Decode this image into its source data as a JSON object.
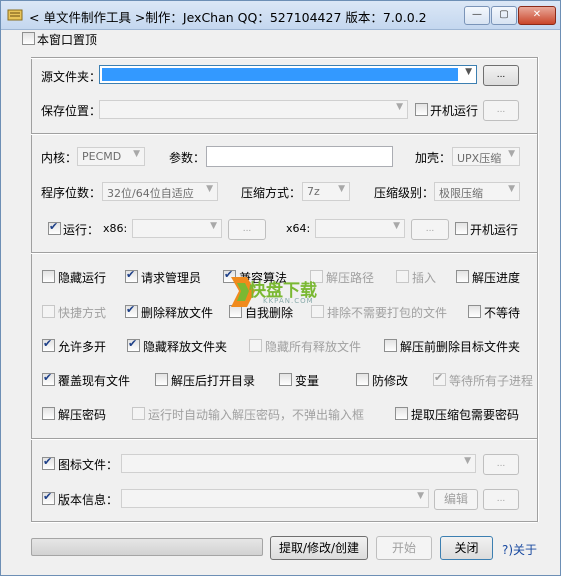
{
  "window": {
    "title": "< 单文件制作工具 >制作：JexChan   QQ：527104427   版本：7.0.0.2",
    "min_glyph": "—",
    "max_glyph": "▢",
    "close_glyph": "✕"
  },
  "top": {
    "always_on_top": "本窗口置顶"
  },
  "source": {
    "label": "源文件夹：",
    "browse": "...",
    "save_label": "保存位置：",
    "save_browse": "...",
    "autorun_label": "开机运行"
  },
  "settings": {
    "kernel_label": "内核：",
    "kernel_value": "PECMD",
    "params_label": "参数：",
    "shell_label": "加壳：",
    "shell_value": "UPX压缩",
    "arch_label": "程序位数：",
    "arch_value": "32位/64位自适应",
    "compress_label": "压缩方式：",
    "compress_value": "7z",
    "level_label": "压缩级别：",
    "level_value": "极限压缩",
    "run_label": "运行：",
    "x86_label": "x86:",
    "x86_browse": "...",
    "x64_label": "x64:",
    "x64_browse": "...",
    "autorun_label": "开机运行"
  },
  "options": {
    "hide_run": "隐藏运行",
    "req_admin": "请求管理员",
    "compat": "兼容算法",
    "extract_path": "解压路径",
    "insert": "插入",
    "extract_progress": "解压进度",
    "shortcut": "快捷方式",
    "del_released": "删除释放文件",
    "self_delete": "自我删除",
    "exclude": "排除不需要打包的文件",
    "no_wait": "不等待",
    "allow_multi": "允许多开",
    "hide_released_folder": "隐藏释放文件夹",
    "hide_all_released": "隐藏所有释放文件",
    "del_target_before": "解压前删除目标文件夹",
    "overwrite": "覆盖现有文件",
    "open_after": "解压后打开目录",
    "variables": "变量",
    "tamper_proof": "防修改",
    "wait_children": "等待所有子进程",
    "extract_password": "解压密码",
    "auto_input_password": "运行时自动输入解压密码，不弹出输入框",
    "need_password": "提取压缩包需要密码"
  },
  "resources": {
    "icon_label": "图标文件：",
    "icon_browse": "...",
    "version_label": "版本信息：",
    "edit": "编辑",
    "version_browse": "..."
  },
  "bottom": {
    "progress": 0,
    "extract_button": "提取/修改/创建",
    "start_button": "开始",
    "close_button": "关闭",
    "about_link": "?)关于"
  },
  "watermark": {
    "text": "快盘下载",
    "sub": "KKPAN.COM"
  },
  "colors": {
    "accent": "#1d3f87",
    "select": "#3399ff",
    "watermark_orange": "#f08a1c",
    "watermark_green": "#7ab832"
  }
}
